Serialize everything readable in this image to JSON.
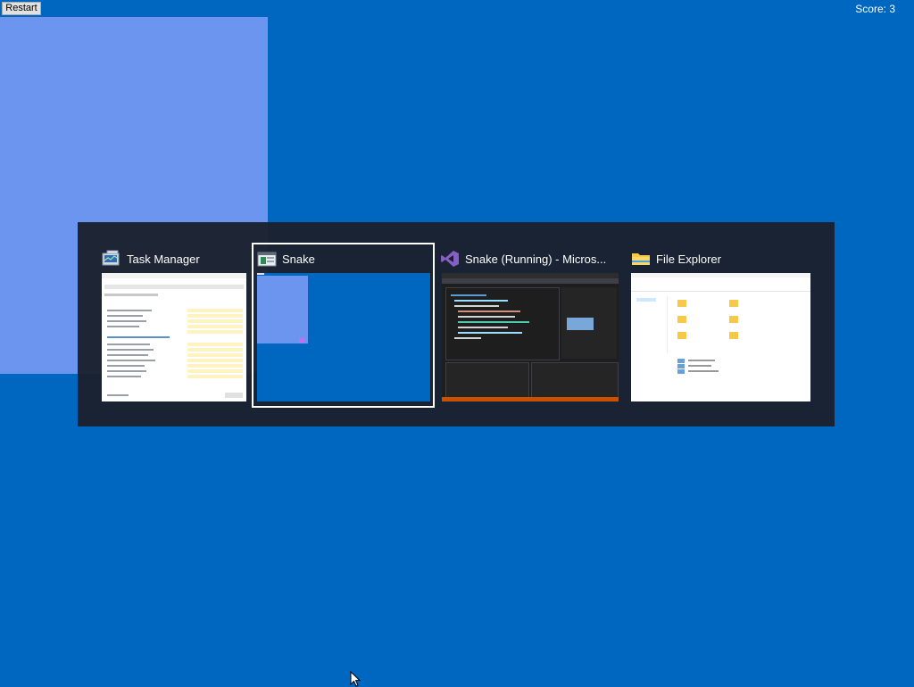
{
  "toolbar": {
    "restart_label": "Restart"
  },
  "game": {
    "score_text": "Score: 3"
  },
  "switcher": {
    "windows": [
      {
        "title": "Task Manager",
        "icon": "task-manager-icon"
      },
      {
        "title": "Snake",
        "icon": "snake-app-icon",
        "selected": true
      },
      {
        "title": "Snake (Running) - Micros...",
        "icon": "visual-studio-icon"
      },
      {
        "title": "File Explorer",
        "icon": "folder-icon"
      }
    ]
  },
  "colors": {
    "desktop": "#0067c0",
    "snake_block": "#6b95ee",
    "switcher_bg": "#1a202b",
    "selection_border": "#ffffff"
  }
}
